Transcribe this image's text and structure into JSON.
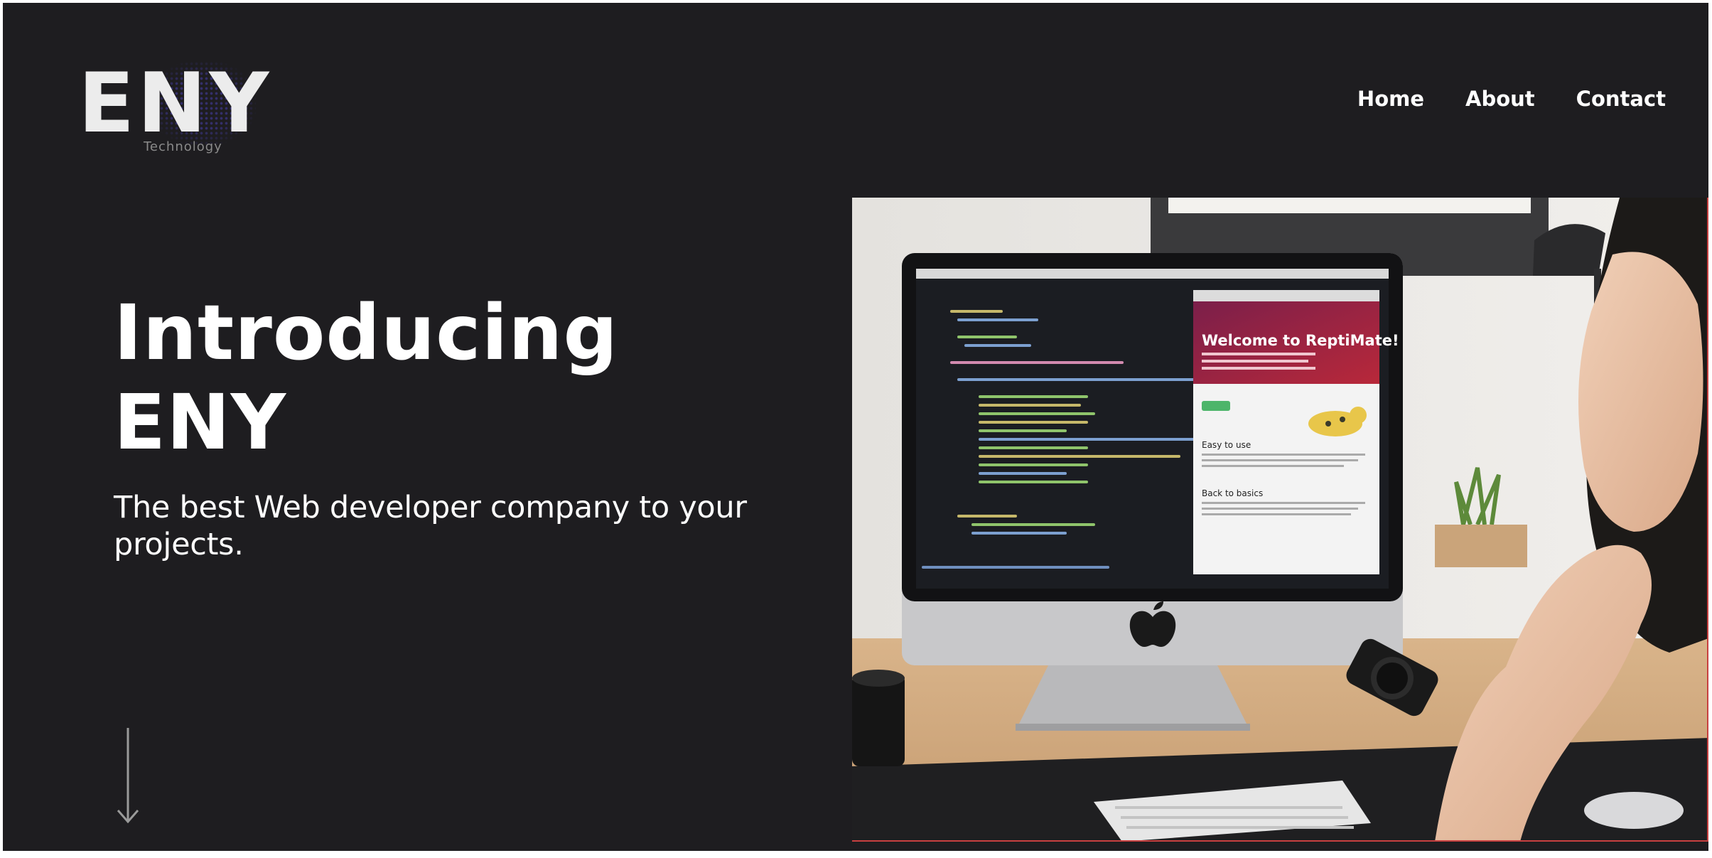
{
  "brand": {
    "name": "ENY",
    "tagline": "Technology"
  },
  "nav": {
    "items": [
      {
        "label": "Home"
      },
      {
        "label": "About"
      },
      {
        "label": "Contact"
      }
    ]
  },
  "hero": {
    "title_line1": "Introducing",
    "title_line2": "ENY",
    "subtitle": "The best Web developer company to your projects."
  },
  "hero_image": {
    "screen_site": {
      "heading": "Welcome to ReptiMate!",
      "section1": "Easy to use",
      "section2": "Back to basics"
    }
  },
  "colors": {
    "background": "#1e1d20",
    "text": "#ffffff",
    "logo_dots": "#463eaa",
    "image_border": "#c84040"
  },
  "icons": {
    "scroll": "arrow-down-icon",
    "computer_logo": "apple-logo-icon"
  }
}
